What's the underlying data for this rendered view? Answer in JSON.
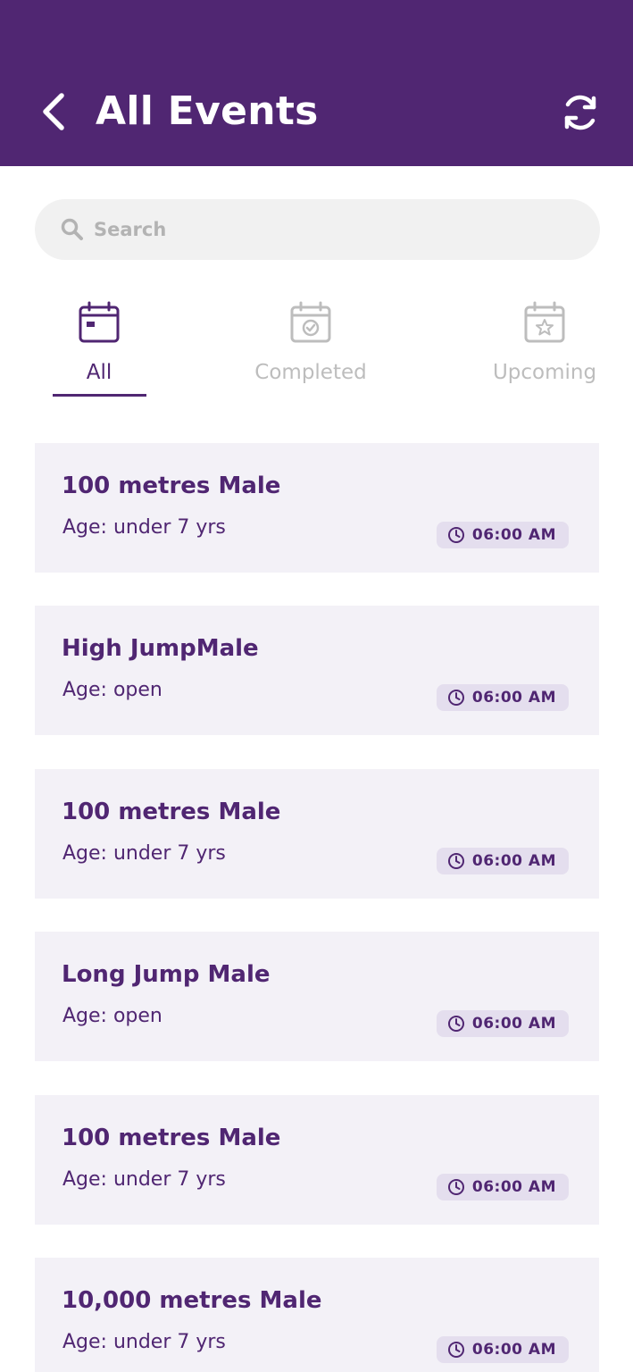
{
  "header": {
    "title": "All Events",
    "back_icon": "chevron-left-icon",
    "refresh_icon": "refresh-icon",
    "background_color": "#502672"
  },
  "search": {
    "placeholder": "Search",
    "value": "",
    "icon": "search-icon"
  },
  "tabs": [
    {
      "label": "All",
      "icon": "calendar-icon",
      "active": true
    },
    {
      "label": "Completed",
      "icon": "calendar-check-icon",
      "active": false
    },
    {
      "label": "Upcoming",
      "icon": "calendar-star-icon",
      "active": false
    }
  ],
  "events": [
    {
      "title": "100 metres Male",
      "age": "Age: under 7 yrs",
      "time": "06:00 AM"
    },
    {
      "title": "High JumpMale",
      "age": "Age: open",
      "time": "06:00 AM"
    },
    {
      "title": "100 metres Male",
      "age": "Age: under 7 yrs",
      "time": "06:00 AM"
    },
    {
      "title": "Long Jump Male",
      "age": "Age: open",
      "time": "06:00 AM"
    },
    {
      "title": "100 metres Male",
      "age": "Age: under 7 yrs",
      "time": "06:00 AM"
    },
    {
      "title": "10,000 metres Male",
      "age": "Age: under 7 yrs",
      "time": "06:00 AM"
    }
  ],
  "colors": {
    "accent": "#502672",
    "card_background": "#f3f1f7",
    "badge_background": "#e4deee",
    "inactive_tab": "#bdbdbd"
  }
}
